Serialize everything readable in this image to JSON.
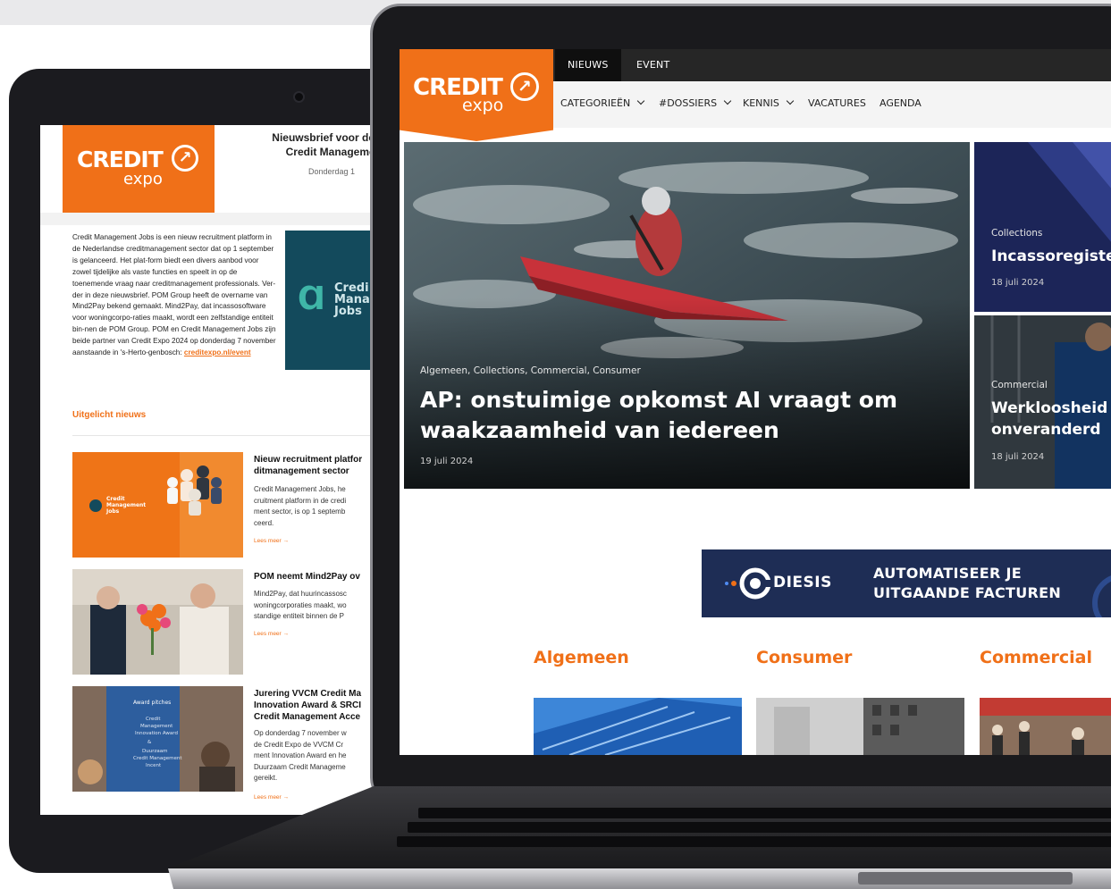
{
  "tablet": {
    "logo": {
      "line1": "CREDIT",
      "line2": "expo"
    },
    "header_lines": [
      "Nieuwsbrief voor de N",
      "Credit Management"
    ],
    "date": "Donderdag 1",
    "intro": "Credit Management Jobs is een nieuw recruitment platform in de Nederlandse creditmanagement sector dat op 1 september is gelanceerd. Het plat-form biedt een divers aanbod voor zowel tijdelijke als vaste functies en speelt in op de toenemende vraag naar creditmanagement professionals. Ver-der in deze nieuwsbrief. POM Group heeft de overname van Mind2Pay bekend gemaakt. Mind2Pay, dat incassosoftware voor woningcorpo-raties maakt, wordt een zelfstandige entiteit bin-nen de POM Group. POM en Credit Management Jobs zijn beide partner van Credit Expo 2024 op donderdag 7 november aanstaande in 's-Herto-genbosch:",
    "intro_link": "creditexpo.nl/event",
    "promo_lines": "Credi\nMana\nJobs",
    "featured_label": "Uitgelicht nieuws",
    "items": [
      {
        "title": "Nieuw recruitment platfor\nditmanagement sector",
        "text": "Credit Management Jobs, he\ncruitment platform in de credi\nment sector, is op 1 septemb\nceerd.",
        "more": "Lees meer →",
        "thumb_label": "Credit\nManagement\nJobs"
      },
      {
        "title": "POM neemt Mind2Pay ov",
        "text": "Mind2Pay, dat huurincassosc\nwoningcorporaties maakt, wo\nstandige entiteit binnen de P",
        "more": "Lees meer →"
      },
      {
        "title": "Jurering VVCM Credit Ma\nInnovation Award & SRCI\nCredit Management Acce",
        "text": "Op donderdag 7 november w\nde Credit Expo de VVCM Cr\nment Innovation Award en he\nDuurzaam Credit Manageme\ngereikt.",
        "more": "Lees meer →",
        "thumb_label": "Award pitches\nCredit\nManagement\nInnovation Award\n&\nDuurzaam\nCredit Management\nIncent"
      }
    ]
  },
  "site": {
    "logo": {
      "line1": "CREDIT",
      "line2": "expo"
    },
    "top_tabs": [
      "NIEUWS",
      "EVENT"
    ],
    "nav": [
      "CATEGORIEËN",
      "#DOSSIERS",
      "KENNIS",
      "VACATURES",
      "AGENDA"
    ],
    "hero": {
      "categories": "Algemeen, Collections, Commercial, Consumer",
      "title": "AP: onstuimige opkomst AI vraagt om waakzaamheid van iedereen",
      "date": "19 juli 2024"
    },
    "side": [
      {
        "category": "Collections",
        "title": "Incassoregiste",
        "date": "18 juli 2024"
      },
      {
        "category": "Commercial",
        "title": "Werkloosheid\nonveranderd",
        "date": "18 juli 2024"
      }
    ],
    "ad": {
      "brand": "DIESIS",
      "message": "AUTOMATISEER JE\nUITGAANDE FACTUREN"
    },
    "sections": [
      "Algemeen",
      "Consumer",
      "Commercial"
    ]
  },
  "colors": {
    "brand_orange": "#f07018",
    "topbar": "#262626",
    "ad_navy": "#1e2d55"
  }
}
